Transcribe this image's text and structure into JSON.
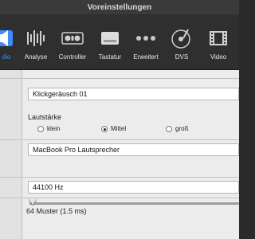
{
  "window": {
    "title": "Voreinstellungen"
  },
  "toolbar": {
    "items": [
      {
        "label": "dio",
        "icon": "speaker-icon",
        "active": true
      },
      {
        "label": "Analyse",
        "icon": "waveform-icon"
      },
      {
        "label": "Controller",
        "icon": "controller-icon"
      },
      {
        "label": "Tastatur",
        "icon": "keyboard-icon"
      },
      {
        "label": "Erweitert",
        "icon": "more-icon"
      },
      {
        "label": "DVS",
        "icon": "turntable-icon"
      },
      {
        "label": "Video",
        "icon": "film-icon"
      }
    ]
  },
  "settings": {
    "click_sound": "Klickgeräusch 01",
    "volume_label": "Lautstärke",
    "volume_options": [
      "klein",
      "Mittel",
      "groß"
    ],
    "volume_selected": "Mittel",
    "output_device": "MacBook Pro Lautsprecher",
    "sample_rate": "44100 Hz",
    "buffer_label": "64 Muster (1.5 ms)",
    "buffer_slider_fraction": 0.0
  },
  "colors": {
    "accent": "#3d8cff"
  }
}
